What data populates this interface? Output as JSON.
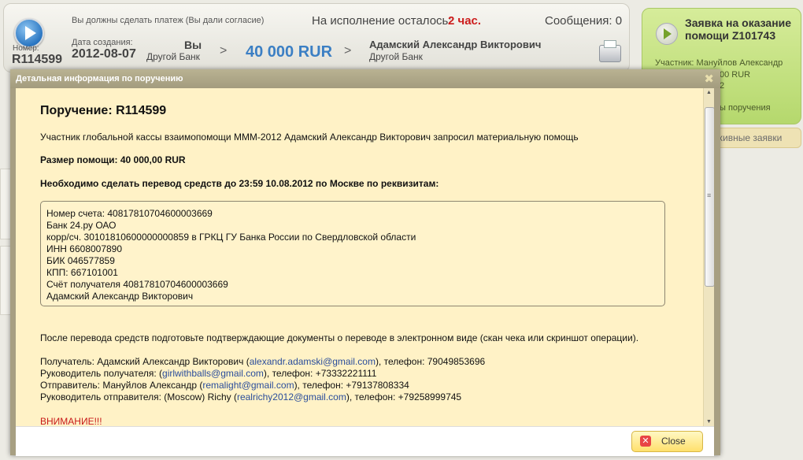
{
  "header": {
    "number_label": "Номер:",
    "number": "R114599",
    "consent_text": "Вы должны сделать платеж (Вы дали согласие)",
    "date_label": "Дата создания:",
    "date": "2012-08-07",
    "remaining_label": "На исполнение осталось:",
    "remaining_value": "2 час.",
    "messages_label": "Сообщения: 0",
    "from_name": "Вы",
    "from_bank": "Другой Банк",
    "arrow": ">",
    "amount": "40 000 RUR",
    "to_name": "Адамский Александр Викторович",
    "to_bank": "Другой Банк"
  },
  "side_card": {
    "title": "Заявка на оказание помощи Z101743",
    "line1": "Участник: Мануйлов Александр",
    "line2": "00 RUR",
    "line3": "2",
    "line4": "ы поручения",
    "archive_label": "хивные заявки"
  },
  "modal": {
    "title": "Детальная информация по поручению",
    "close_x": "✖",
    "heading": "Поручение: R114599",
    "intro": "Участник глобальной кассы взаимопомощи МММ-2012 Адамский Александр Викторович запросил материальную помощь",
    "amount_line": "Размер помощи: 40 000,00 RUR",
    "deadline_line": "Необходимо сделать перевод средств до 23:59 10.08.2012 по Москве по реквизитам:",
    "details": [
      "Номер счета: 40817810704600003669",
      "Банк 24.ру ОАО",
      "корр/сч. 30101810600000000859 в ГРКЦ ГУ Банка России по Свердловской области",
      "ИНН 6608007890",
      "БИК 046577859",
      "КПП: 667101001",
      "Счёт получателя 40817810704600003669",
      "Адамский Александр Викторович"
    ],
    "after_transfer": "После перевода средств подготовьте подтверждающие документы о переводе в электронном виде (скан чека или скриншот операции).",
    "contacts": {
      "recipient_prefix": "Получатель: Адамский Александр Викторович (",
      "recipient_email": "alexandr.adamski@gmail.com",
      "recipient_suffix": "), телефон: 79049853696",
      "recipient_head_prefix": "Руководитель получателя: (",
      "recipient_head_email": "girlwithballs@gmail.com",
      "recipient_head_suffix": "), телефон: +73332221111",
      "sender_prefix": "Отправитель: Мануйлов Александр (",
      "sender_email": "remalight@gmail.com",
      "sender_suffix": "), телефон: +79137808334",
      "sender_head_prefix": "Руководитель отправителя: (Moscow) Richy (",
      "sender_head_email": "realrichy2012@gmail.com",
      "sender_head_suffix": "), телефон: +79258999745"
    },
    "warning": "ВНИМАНИЕ!!!",
    "close_button": "Close"
  }
}
